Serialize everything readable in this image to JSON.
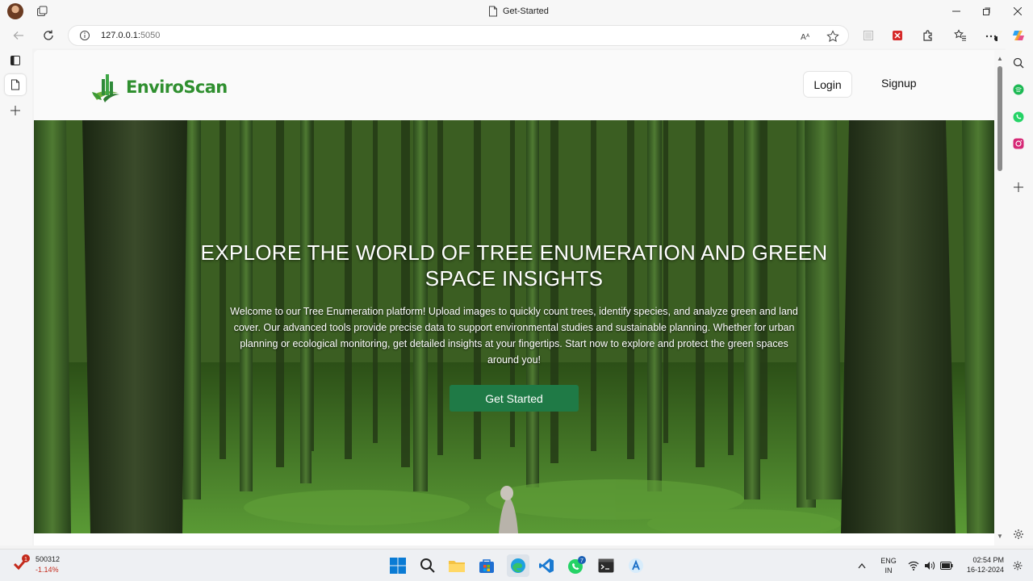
{
  "browser": {
    "tab_title": "Get-Started",
    "url_host": "127.0.0.1:",
    "url_port": "5050"
  },
  "site": {
    "brand": "EnviroScan",
    "nav": {
      "login": "Login",
      "signup": "Signup"
    },
    "hero": {
      "title": "EXPLORE THE WORLD OF TREE ENUMERATION AND GREEN SPACE INSIGHTS",
      "description": "Welcome to our Tree Enumeration platform! Upload images to quickly count trees, identify species, and analyze green and land cover. Our advanced tools provide precise data to support environmental studies and sustainable planning. Whether for urban planning or ecological monitoring, get detailed insights at your fingertips. Start now to explore and protect the green spaces around you!",
      "cta": "Get Started"
    }
  },
  "taskbar": {
    "stock": {
      "badge": "1",
      "name": "500312",
      "change": "-1.14%"
    },
    "whatsapp_badge": "7",
    "lang": "ENG",
    "region": "IN",
    "time": "02:54 PM",
    "date": "16-12-2024"
  },
  "colors": {
    "brand_green": "#2f8f2f",
    "cta_green": "#1f7a46",
    "stock_red": "#c42b1c"
  }
}
